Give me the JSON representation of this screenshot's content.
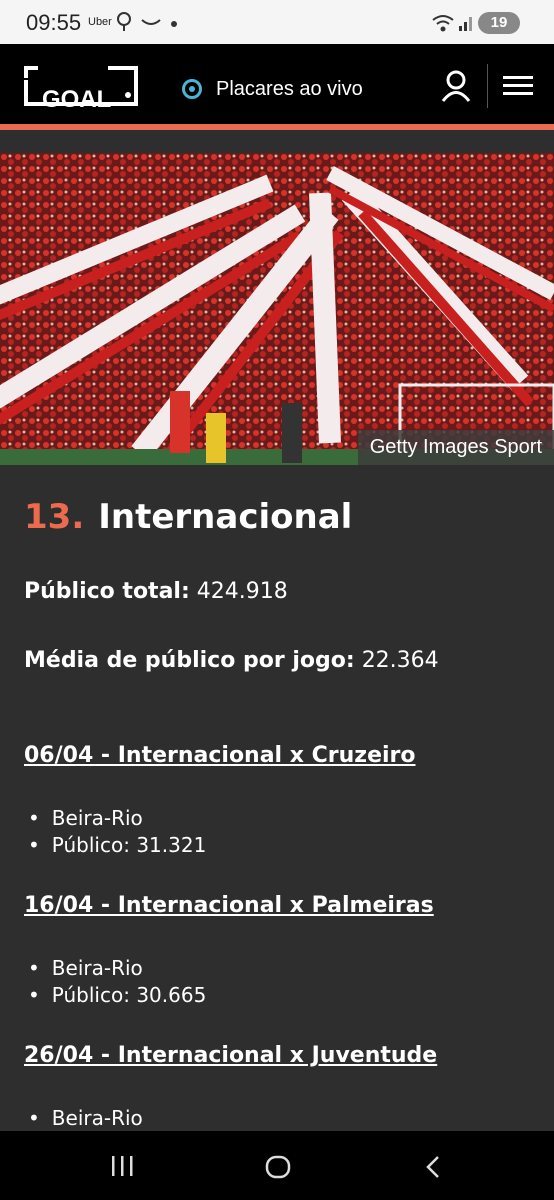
{
  "status_bar": {
    "time": "09:55",
    "uber": "Uber",
    "battery": "19"
  },
  "header": {
    "logo_text": "GOAL",
    "live_label": "Placares ao vivo"
  },
  "hero": {
    "caption": "Getty Images Sport"
  },
  "article": {
    "rank": "13.",
    "team": "Internacional",
    "stats": [
      {
        "label": "Público total:",
        "value": "424.918"
      },
      {
        "label": "Média de público por jogo:",
        "value": "22.364"
      }
    ],
    "matches": [
      {
        "title": "06/04 - Internacional x Cruzeiro",
        "venue": "Beira-Rio",
        "attendance": "Público: 31.321"
      },
      {
        "title": "16/04 - Internacional x Palmeiras",
        "venue": "Beira-Rio",
        "attendance": "Público: 30.665"
      },
      {
        "title": "26/04 - Internacional x Juventude",
        "venue": "Beira-Rio",
        "attendance": ""
      }
    ]
  },
  "colors": {
    "accent": "#ec6a4e",
    "live": "#4ab3d6",
    "background": "#2e2e2e"
  }
}
